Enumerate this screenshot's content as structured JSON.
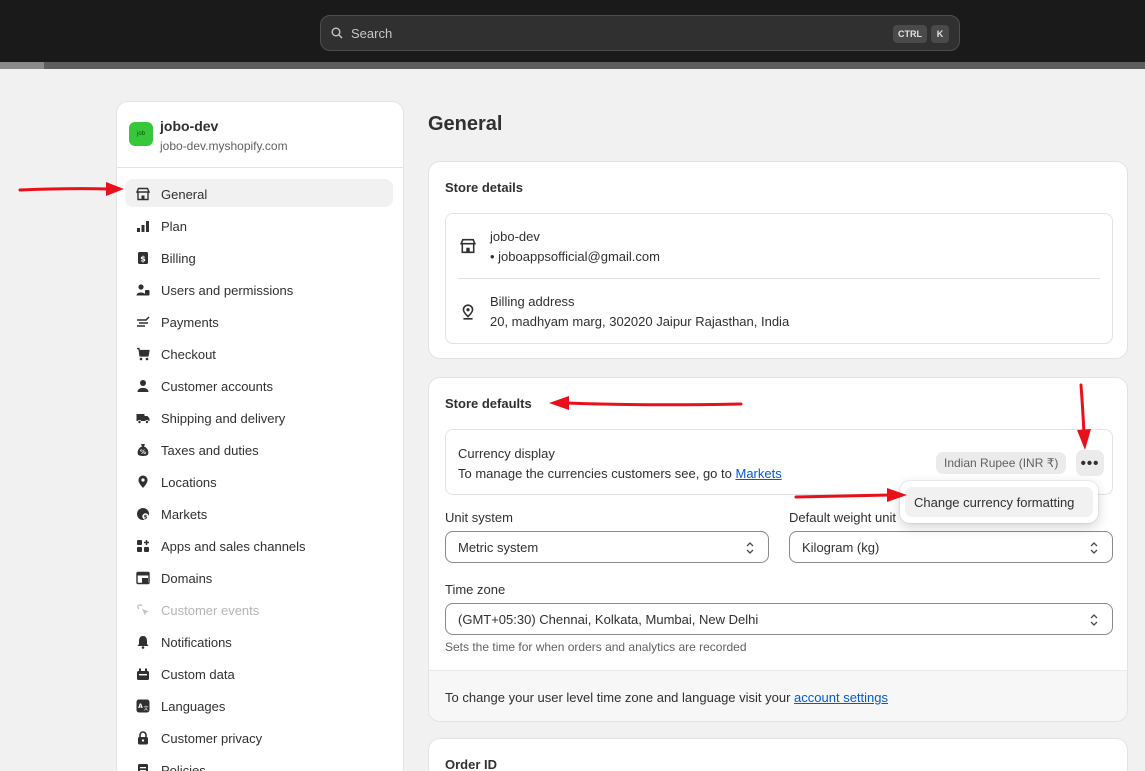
{
  "topbar": {
    "search_placeholder": "Search",
    "shortcut_ctrl": "CTRL",
    "shortcut_key": "K"
  },
  "store": {
    "avatar_text": "job",
    "name": "jobo-dev",
    "domain": "jobo-dev.myshopify.com"
  },
  "sidebar": {
    "items": [
      {
        "label": "General",
        "icon": "store-icon"
      },
      {
        "label": "Plan",
        "icon": "plan-icon"
      },
      {
        "label": "Billing",
        "icon": "billing-icon"
      },
      {
        "label": "Users and permissions",
        "icon": "users-icon"
      },
      {
        "label": "Payments",
        "icon": "payments-icon"
      },
      {
        "label": "Checkout",
        "icon": "cart-icon"
      },
      {
        "label": "Customer accounts",
        "icon": "person-icon"
      },
      {
        "label": "Shipping and delivery",
        "icon": "truck-icon"
      },
      {
        "label": "Taxes and duties",
        "icon": "tax-icon"
      },
      {
        "label": "Locations",
        "icon": "location-icon"
      },
      {
        "label": "Markets",
        "icon": "globe-icon"
      },
      {
        "label": "Apps and sales channels",
        "icon": "apps-icon"
      },
      {
        "label": "Domains",
        "icon": "domains-icon"
      },
      {
        "label": "Customer events",
        "icon": "cursor-icon"
      },
      {
        "label": "Notifications",
        "icon": "bell-icon"
      },
      {
        "label": "Custom data",
        "icon": "custom-data-icon"
      },
      {
        "label": "Languages",
        "icon": "language-icon"
      },
      {
        "label": "Customer privacy",
        "icon": "lock-icon"
      },
      {
        "label": "Policies",
        "icon": "policies-icon"
      }
    ]
  },
  "main": {
    "title": "General",
    "store_details": {
      "title": "Store details",
      "store_name": "jobo-dev",
      "store_email": "• joboappsofficial@gmail.com",
      "billing_label": "Billing address",
      "billing_address": "20, madhyam marg, 302020 Jaipur Rajasthan, India"
    },
    "store_defaults": {
      "title": "Store defaults",
      "currency_title": "Currency display",
      "currency_sub": "To manage the currencies customers see, go to ",
      "currency_link": "Markets",
      "currency_badge": "Indian Rupee (INR ₹)",
      "more_label": "•••",
      "popover_item": "Change currency formatting",
      "unit_label": "Unit system",
      "unit_value": "Metric system",
      "weight_label": "Default weight unit",
      "weight_value": "Kilogram (kg)",
      "timezone_label": "Time zone",
      "timezone_value": "(GMT+05:30) Chennai, Kolkata, Mumbai, New Delhi",
      "timezone_help": "Sets the time for when orders and analytics are recorded",
      "footer_text": "To change your user level time zone and language visit your ",
      "footer_link": "account settings"
    },
    "order_id": {
      "title": "Order ID"
    }
  },
  "colors": {
    "accent_link": "#005bd3",
    "annotation_arrow": "#e8101a",
    "store_avatar": "#36c83a"
  }
}
